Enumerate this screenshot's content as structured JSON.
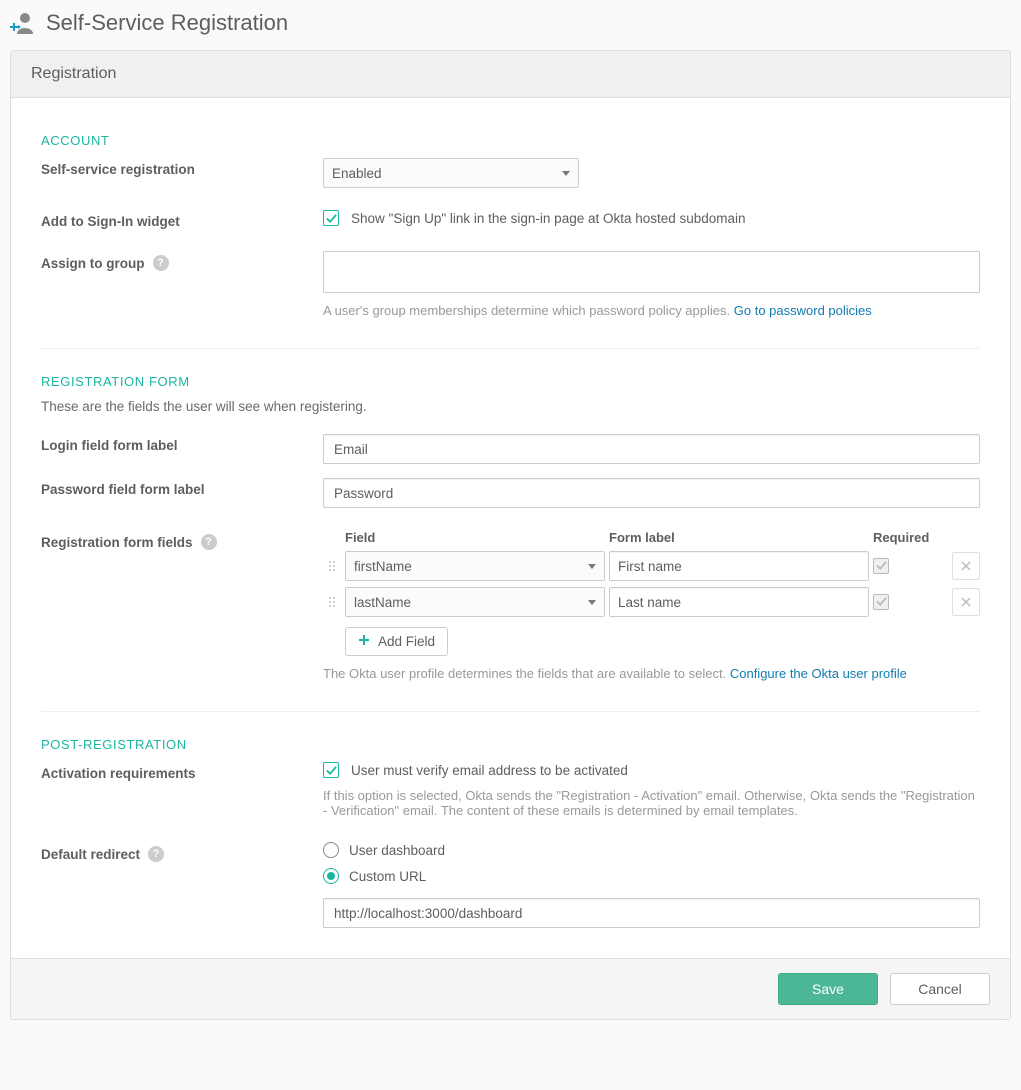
{
  "page": {
    "title": "Self-Service Registration",
    "panel_title": "Registration"
  },
  "account": {
    "section_label": "ACCOUNT",
    "self_service_label": "Self-service registration",
    "self_service_value": "Enabled",
    "add_to_widget_label": "Add to Sign-In widget",
    "add_to_widget_checkbox_label": "Show \"Sign Up\" link in the sign-in page at Okta hosted subdomain",
    "add_to_widget_checked": true,
    "assign_group_label": "Assign to group",
    "assign_group_value": "",
    "assign_group_hint": "A user's group memberships determine which password policy applies.",
    "assign_group_link": "Go to password policies"
  },
  "registration_form": {
    "section_label": "REGISTRATION FORM",
    "section_desc": "These are the fields the user will see when registering.",
    "login_label_field_label": "Login field form label",
    "login_label_value": "Email",
    "password_label_field_label": "Password field form label",
    "password_label_value": "Password",
    "form_fields_label": "Registration form fields",
    "headers": {
      "field": "Field",
      "form_label": "Form label",
      "required": "Required"
    },
    "rows": [
      {
        "field": "firstName",
        "label": "First name",
        "required": true
      },
      {
        "field": "lastName",
        "label": "Last name",
        "required": true
      }
    ],
    "add_field_label": "Add Field",
    "hint": "The Okta user profile determines the fields that are available to select.",
    "hint_link": "Configure the Okta user profile"
  },
  "post_registration": {
    "section_label": "POST-REGISTRATION",
    "activation_label": "Activation requirements",
    "activation_checkbox_label": "User must verify email address to be activated",
    "activation_checked": true,
    "activation_hint": "If this option is selected, Okta sends the \"Registration - Activation\" email. Otherwise, Okta sends the \"Registration - Verification\" email. The content of these emails is determined by email templates.",
    "default_redirect_label": "Default redirect",
    "redirect_options": {
      "user_dashboard": "User dashboard",
      "custom_url": "Custom URL"
    },
    "selected_redirect": "custom_url",
    "custom_url_value": "http://localhost:3000/dashboard"
  },
  "footer": {
    "save": "Save",
    "cancel": "Cancel"
  }
}
